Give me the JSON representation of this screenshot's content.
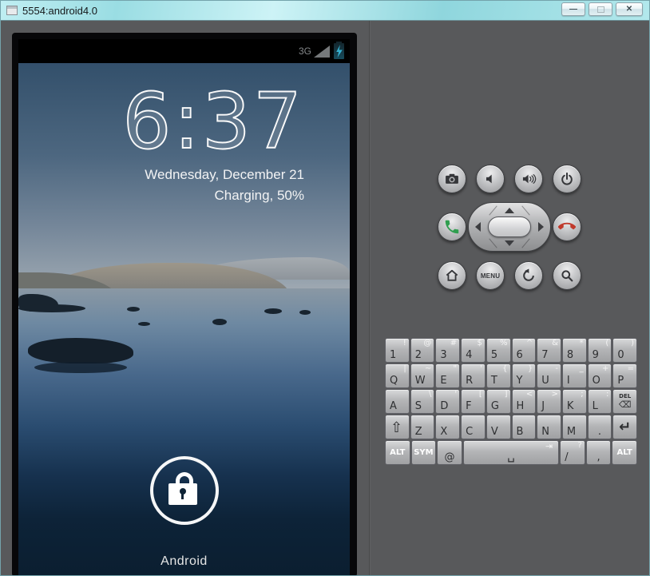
{
  "window": {
    "title": "5554:android4.0",
    "minimize_glyph": "—",
    "close_glyph": "✕"
  },
  "status_bar": {
    "network_label": "3G"
  },
  "lock_screen": {
    "time": "6:37",
    "date": "Wednesday, December 21",
    "charging_status": "Charging, 50%",
    "brand_label": "Android"
  },
  "controls": {
    "menu_label": "MENU",
    "row1": [
      {
        "name": "camera-button",
        "icon": "camera"
      },
      {
        "name": "volume-down-button",
        "icon": "volume-down"
      },
      {
        "name": "volume-up-button",
        "icon": "volume-up"
      },
      {
        "name": "power-button",
        "icon": "power"
      }
    ],
    "row2_left": [
      {
        "name": "call-button",
        "icon": "call"
      }
    ],
    "row2_right": [
      {
        "name": "end-call-button",
        "icon": "end-call"
      }
    ],
    "row3": [
      {
        "name": "home-button",
        "icon": "home"
      },
      {
        "name": "menu-button",
        "icon": "menu"
      },
      {
        "name": "back-button",
        "icon": "back"
      },
      {
        "name": "search-button",
        "icon": "search"
      }
    ]
  },
  "keyboard": {
    "rows": [
      [
        {
          "main": "1",
          "alt": "!"
        },
        {
          "main": "2",
          "alt": "@"
        },
        {
          "main": "3",
          "alt": "#"
        },
        {
          "main": "4",
          "alt": "$"
        },
        {
          "main": "5",
          "alt": "%"
        },
        {
          "main": "6",
          "alt": "^"
        },
        {
          "main": "7",
          "alt": "&"
        },
        {
          "main": "8",
          "alt": "*"
        },
        {
          "main": "9",
          "alt": "("
        },
        {
          "main": "0",
          "alt": ")"
        }
      ],
      [
        {
          "main": "Q",
          "alt": "|"
        },
        {
          "main": "W",
          "alt": "~"
        },
        {
          "main": "E",
          "alt": "\""
        },
        {
          "main": "R",
          "alt": "'"
        },
        {
          "main": "T",
          "alt": "{"
        },
        {
          "main": "Y",
          "alt": "}"
        },
        {
          "main": "U",
          "alt": "-"
        },
        {
          "main": "I",
          "alt": "_"
        },
        {
          "main": "O",
          "alt": "+"
        },
        {
          "main": "P",
          "alt": "="
        }
      ],
      [
        {
          "main": "A"
        },
        {
          "main": "S",
          "alt": "\\"
        },
        {
          "main": "D",
          "alt": "'"
        },
        {
          "main": "F",
          "alt": "["
        },
        {
          "main": "G",
          "alt": "]"
        },
        {
          "main": "H",
          "alt": "<"
        },
        {
          "main": "J",
          "alt": ">"
        },
        {
          "main": "K",
          "alt": ";"
        },
        {
          "main": "L",
          "alt": ":"
        },
        {
          "main": "DEL",
          "glyph": "⌫",
          "kind": "del",
          "name": "key-del"
        }
      ],
      [
        {
          "main": "⇧",
          "kind": "shift",
          "name": "key-shift"
        },
        {
          "main": "Z"
        },
        {
          "main": "X"
        },
        {
          "main": "C"
        },
        {
          "main": "V"
        },
        {
          "main": "B"
        },
        {
          "main": "N"
        },
        {
          "main": "M"
        },
        {
          "main": ".",
          "kind": "center",
          "name": "key-period"
        },
        {
          "main": "↵",
          "kind": "enter",
          "name": "key-enter"
        }
      ],
      [
        {
          "main": "ALT",
          "kind": "mod",
          "name": "key-alt-left"
        },
        {
          "main": "SYM",
          "kind": "mod",
          "name": "key-sym"
        },
        {
          "main": "@",
          "kind": "center",
          "name": "key-at"
        },
        {
          "main": "␣",
          "alt": "⇥",
          "kind": "space",
          "w": 4,
          "name": "key-space"
        },
        {
          "main": "/",
          "alt": "?",
          "name": "key-slash"
        },
        {
          "main": ",",
          "kind": "center",
          "name": "key-comma"
        },
        {
          "main": "ALT",
          "kind": "mod",
          "name": "key-alt-right"
        }
      ]
    ]
  },
  "colors": {
    "titlebar": "#9fdde2",
    "panel_background": "#58595b",
    "key_face": "#b4b5b7",
    "battery_bolt": "#36b0cf",
    "call_green": "#2f9e4f",
    "end_call_red": "#c0392b",
    "lock_ring": "#ffffff"
  }
}
